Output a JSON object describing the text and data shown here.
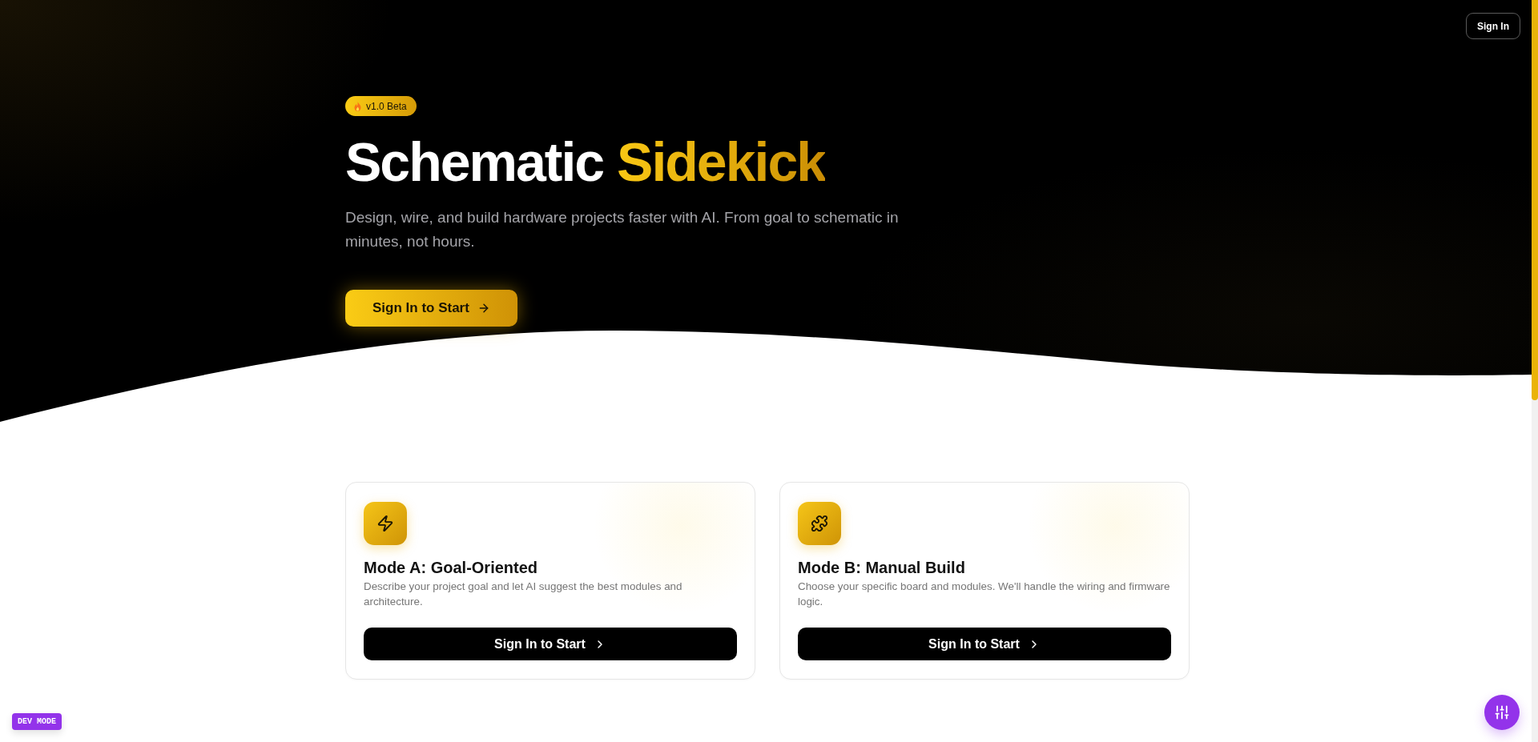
{
  "header": {
    "sign_in_button": "Sign In"
  },
  "hero": {
    "badge": "v1.0 Beta",
    "title": "Schematic",
    "title_highlight": "Sidekick",
    "subtitle": "Design, wire, and build hardware projects faster with AI. From goal to schematic in minutes, not hours.",
    "cta_button": "Sign In to Start"
  },
  "modes": [
    {
      "kind": "goal",
      "title": "Mode A: Goal-Oriented",
      "description": "Describe your project goal and let AI suggest the best modules and architecture.",
      "button": "Sign In to Start"
    },
    {
      "kind": "manual",
      "title": "Mode B: Manual Build",
      "description": "Choose your specific board and modules. We'll handle the wiring and firmware logic.",
      "button": "Sign In to Start"
    }
  ],
  "dev_badge": "DEV MODE"
}
